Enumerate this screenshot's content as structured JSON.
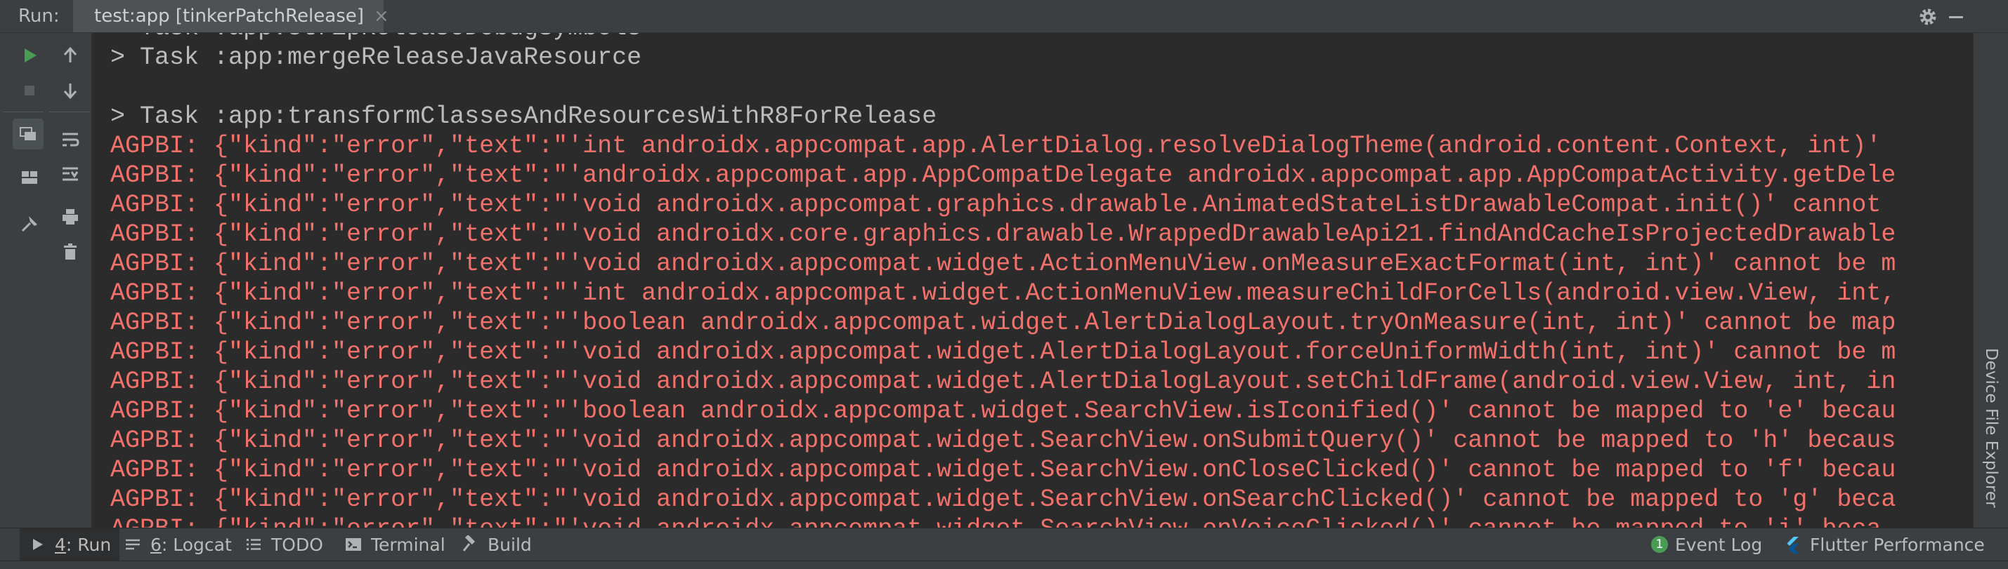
{
  "colors": {
    "error_text": "#f2716b",
    "task_text": "#bbbbbb",
    "console_bg": "#2b2b2b",
    "panel_bg": "#3c3f41",
    "accent_green": "#499c54"
  },
  "header": {
    "run_label": "Run:",
    "tab_title": "test:app [tinkerPatchRelease]",
    "tab_close": "×",
    "icons": [
      "android-icon",
      "gear-icon",
      "minimize-icon"
    ]
  },
  "toolbar": {
    "icons": [
      "run-icon",
      "stop-icon",
      "restore-layout-icon",
      "layout-icon",
      "pin-icon",
      "scroll-up-icon",
      "scroll-down-icon",
      "soft-wrap-icon",
      "scroll-to-end-icon",
      "print-icon",
      "trash-icon"
    ]
  },
  "console": {
    "lines": [
      {
        "kind": "task",
        "text": "> Task :app:stripReleaseDebugSymbols"
      },
      {
        "kind": "task",
        "text": "> Task :app:mergeReleaseJavaResource"
      },
      {
        "kind": "blank",
        "text": ""
      },
      {
        "kind": "task",
        "text": "> Task :app:transformClassesAndResourcesWithR8ForRelease"
      },
      {
        "kind": "error",
        "text": "AGPBI: {\"kind\":\"error\",\"text\":\"'int androidx.appcompat.app.AlertDialog.resolveDialogTheme(android.content.Context, int)'"
      },
      {
        "kind": "error",
        "text": "AGPBI: {\"kind\":\"error\",\"text\":\"'androidx.appcompat.app.AppCompatDelegate androidx.appcompat.app.AppCompatActivity.getDele"
      },
      {
        "kind": "error",
        "text": "AGPBI: {\"kind\":\"error\",\"text\":\"'void androidx.appcompat.graphics.drawable.AnimatedStateListDrawableCompat.init()' cannot"
      },
      {
        "kind": "error",
        "text": "AGPBI: {\"kind\":\"error\",\"text\":\"'void androidx.core.graphics.drawable.WrappedDrawableApi21.findAndCacheIsProjectedDrawable"
      },
      {
        "kind": "error",
        "text": "AGPBI: {\"kind\":\"error\",\"text\":\"'void androidx.appcompat.widget.ActionMenuView.onMeasureExactFormat(int, int)' cannot be m"
      },
      {
        "kind": "error",
        "text": "AGPBI: {\"kind\":\"error\",\"text\":\"'int androidx.appcompat.widget.ActionMenuView.measureChildForCells(android.view.View, int,"
      },
      {
        "kind": "error",
        "text": "AGPBI: {\"kind\":\"error\",\"text\":\"'boolean androidx.appcompat.widget.AlertDialogLayout.tryOnMeasure(int, int)' cannot be map"
      },
      {
        "kind": "error",
        "text": "AGPBI: {\"kind\":\"error\",\"text\":\"'void androidx.appcompat.widget.AlertDialogLayout.forceUniformWidth(int, int)' cannot be m"
      },
      {
        "kind": "error",
        "text": "AGPBI: {\"kind\":\"error\",\"text\":\"'void androidx.appcompat.widget.AlertDialogLayout.setChildFrame(android.view.View, int, in"
      },
      {
        "kind": "error",
        "text": "AGPBI: {\"kind\":\"error\",\"text\":\"'boolean androidx.appcompat.widget.SearchView.isIconified()' cannot be mapped to 'e' becau"
      },
      {
        "kind": "error",
        "text": "AGPBI: {\"kind\":\"error\",\"text\":\"'void androidx.appcompat.widget.SearchView.onSubmitQuery()' cannot be mapped to 'h' becaus"
      },
      {
        "kind": "error",
        "text": "AGPBI: {\"kind\":\"error\",\"text\":\"'void androidx.appcompat.widget.SearchView.onCloseClicked()' cannot be mapped to 'f' becau"
      },
      {
        "kind": "error",
        "text": "AGPBI: {\"kind\":\"error\",\"text\":\"'void androidx.appcompat.widget.SearchView.onSearchClicked()' cannot be mapped to 'g' beca"
      },
      {
        "kind": "error",
        "text": "AGPBI: {\"kind\":\"error\",\"text\":\"'void androidx.appcompat.widget.SearchView.onVoiceClicked()' cannot be mapped to 'i' beca"
      }
    ]
  },
  "right_panel": {
    "device_file_explorer": "Device File Explorer"
  },
  "bottom_tabs": {
    "run": {
      "mnemonic": "4",
      "label": ": Run"
    },
    "logcat": {
      "mnemonic": "6",
      "label": ": Logcat"
    },
    "todo": "TODO",
    "terminal": "Terminal",
    "build": "Build",
    "event_log": "Event Log",
    "event_log_count": "1",
    "flutter_performance": "Flutter Performance"
  }
}
